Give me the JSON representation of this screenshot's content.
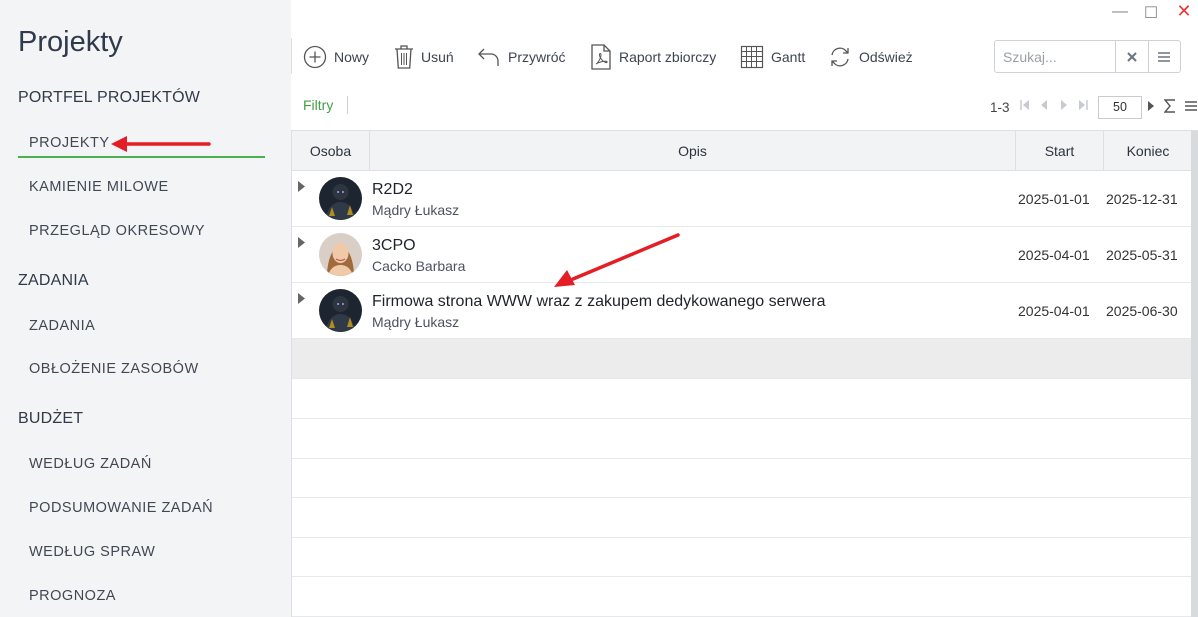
{
  "app": {
    "title": "Projekty"
  },
  "window": {
    "minimize": "—",
    "maximize": "☐",
    "close": "✕"
  },
  "sidebar": {
    "sections": [
      {
        "title": "PORTFEL PROJEKTÓW",
        "items": [
          "PROJEKTY",
          "KAMIENIE MILOWE",
          "PRZEGLĄD OKRESOWY"
        ]
      },
      {
        "title": "ZADANIA",
        "items": [
          "ZADANIA",
          "OBŁOŻENIE ZASOBÓW"
        ]
      },
      {
        "title": "BUDŻET",
        "items": [
          "WEDŁUG ZADAŃ",
          "PODSUMOWANIE ZADAŃ",
          "WEDŁUG SPRAW",
          "PROGNOZA"
        ]
      }
    ],
    "active_item": "PROJEKTY"
  },
  "toolbar": {
    "new_label": "Nowy",
    "delete_label": "Usuń",
    "restore_label": "Przywróć",
    "report_label": "Raport zbiorczy",
    "gantt_label": "Gantt",
    "refresh_label": "Odśwież"
  },
  "search": {
    "placeholder": "Szukaj...",
    "value": ""
  },
  "filters_label": "Filtry",
  "pager": {
    "range": "1-3",
    "page_size": "50"
  },
  "grid": {
    "columns": {
      "person": "Osoba",
      "description": "Opis",
      "start": "Start",
      "end": "Koniec"
    },
    "rows": [
      {
        "title": "R2D2",
        "owner": "Mądry Łukasz",
        "start": "2025-01-01",
        "end": "2025-12-31"
      },
      {
        "title": "3CPO",
        "owner": "Cacko Barbara",
        "start": "2025-04-01",
        "end": "2025-05-31"
      },
      {
        "title": "Firmowa strona WWW wraz z zakupem dedykowanego serwera",
        "owner": "Mądry Łukasz",
        "start": "2025-04-01",
        "end": "2025-06-30"
      }
    ]
  },
  "colors": {
    "accent": "#4caf50",
    "annotation_arrow": "#e31e24",
    "close": "#e53935"
  }
}
